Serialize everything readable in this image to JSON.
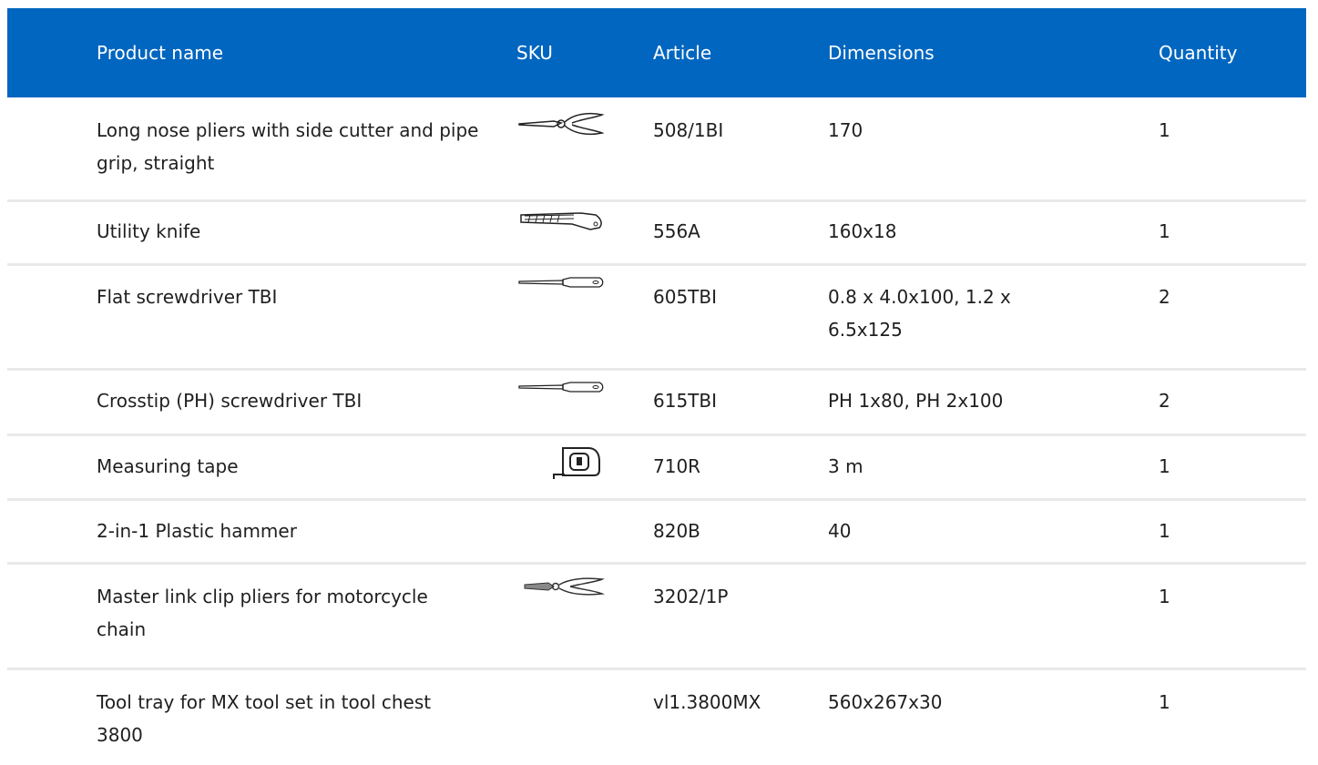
{
  "header": {
    "product_name": "Product name",
    "sku": "SKU",
    "article": "Article",
    "dimensions": "Dimensions",
    "quantity": "Quantity"
  },
  "colors": {
    "header_bg": "#0066bf",
    "divider": "#e9e9e9"
  },
  "rows": [
    {
      "name": "Long nose pliers with side cutter and pipe grip, straight",
      "icon": "long-nose-pliers-icon",
      "article": "508/1BI",
      "dimensions": "170",
      "quantity": "1"
    },
    {
      "name": "Utility knife",
      "icon": "utility-knife-icon",
      "article": "556A",
      "dimensions": "160x18",
      "quantity": "1"
    },
    {
      "name": "Flat screwdriver TBI",
      "icon": "flat-screwdriver-icon",
      "article": "605TBI",
      "dimensions": "0.8 x 4.0x100, 1.2 x 6.5x125",
      "quantity": "2"
    },
    {
      "name": "Crosstip (PH) screwdriver TBI",
      "icon": "crosstip-screwdriver-icon",
      "article": "615TBI",
      "dimensions": "PH 1x80, PH 2x100",
      "quantity": "2"
    },
    {
      "name": "Measuring tape",
      "icon": "measuring-tape-icon",
      "article": "710R",
      "dimensions": "3 m",
      "quantity": "1"
    },
    {
      "name": "2-in-1 Plastic hammer",
      "icon": "",
      "article": "820B",
      "dimensions": "40",
      "quantity": "1"
    },
    {
      "name": "Master link clip pliers for motorcycle chain",
      "icon": "master-link-pliers-icon",
      "article": "3202/1P",
      "dimensions": "",
      "quantity": "1"
    },
    {
      "name": "Tool tray for MX tool set in tool chest 3800",
      "icon": "",
      "article": "vl1.3800MX",
      "dimensions": "560x267x30",
      "quantity": "1"
    }
  ]
}
